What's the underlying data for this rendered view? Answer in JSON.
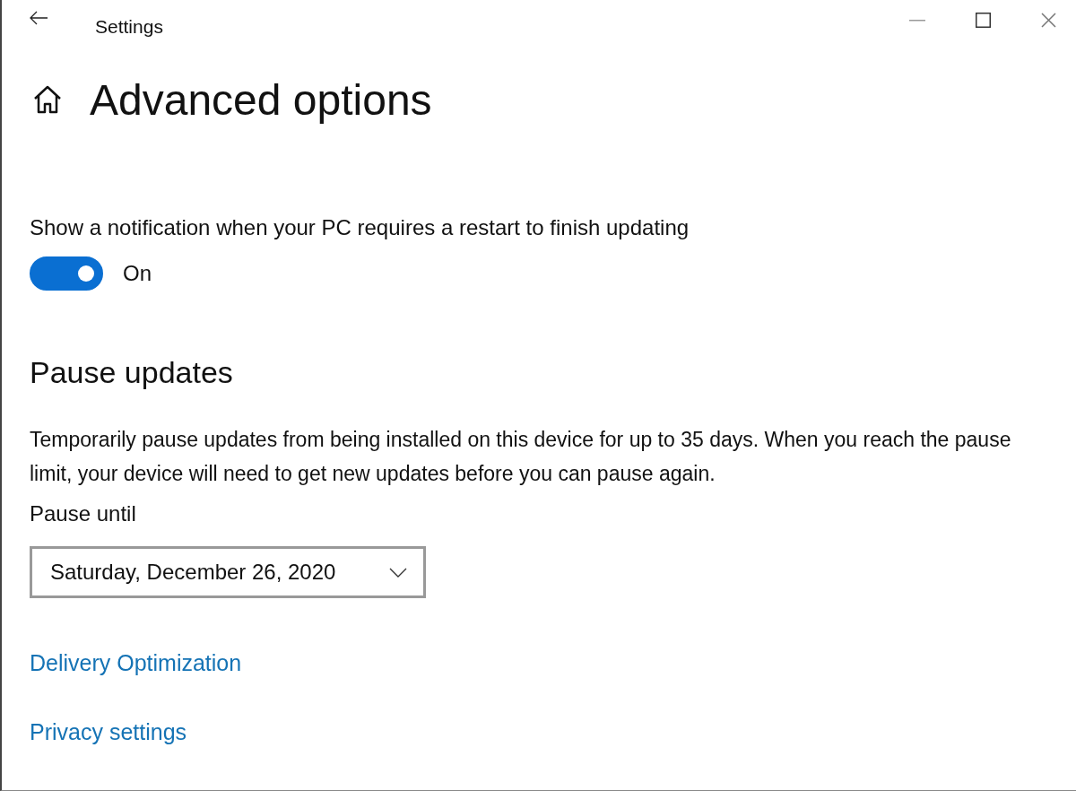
{
  "window": {
    "title": "Settings"
  },
  "page_title": "Advanced options",
  "update_notifications": {
    "label": "Show a notification when your PC requires a restart to finish updating",
    "toggle": {
      "on": true,
      "state_text": "On"
    }
  },
  "pause_updates": {
    "heading": "Pause updates",
    "description": "Temporarily pause updates from being installed on this device for up to 35 days. When you reach the pause limit, your device will need to get new updates before you can pause again.",
    "field_label": "Pause until",
    "dropdown": {
      "value": "Saturday, December 26, 2020"
    }
  },
  "links": [
    "Delivery Optimization",
    "Privacy settings"
  ]
}
